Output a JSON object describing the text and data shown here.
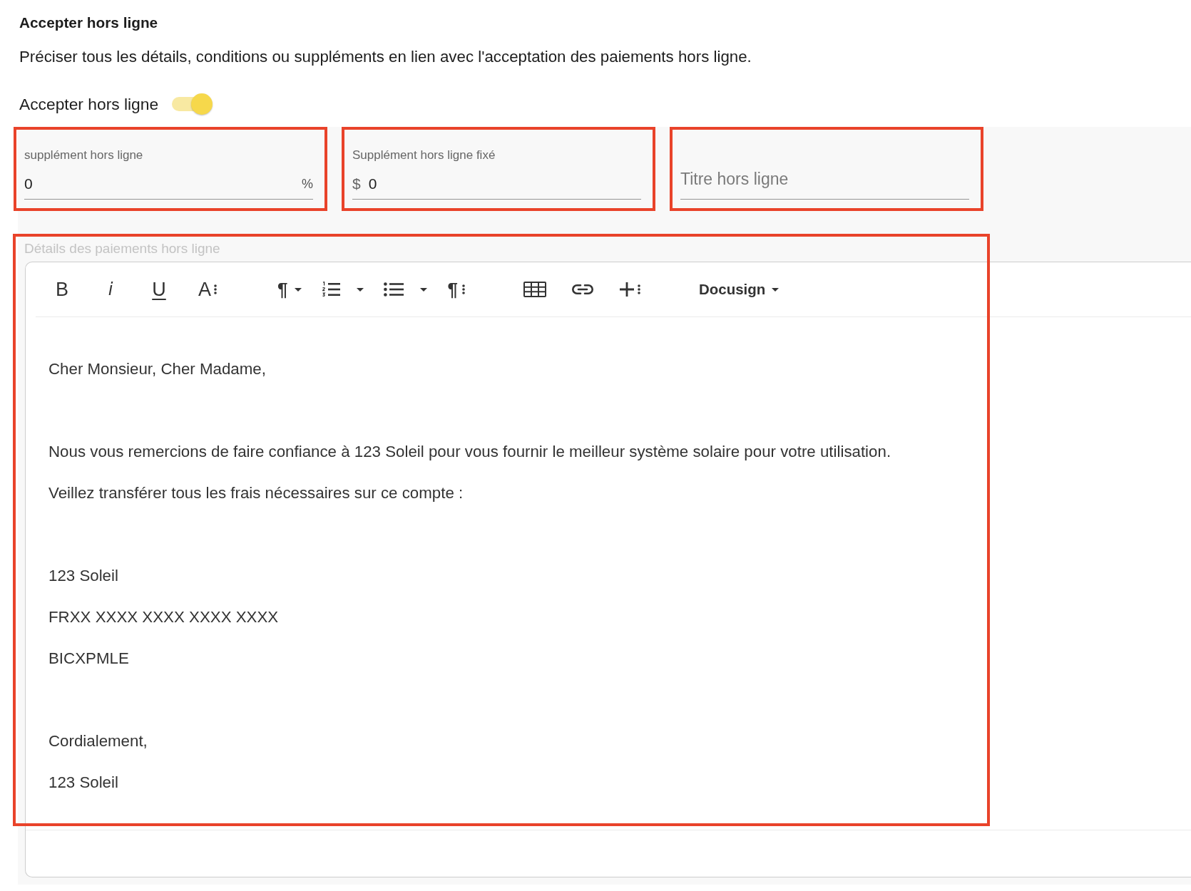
{
  "section": {
    "title": "Accepter hors ligne",
    "description": "Préciser tous les détails, conditions ou suppléments en lien avec l'acceptation des paiements hors ligne."
  },
  "offline_toggle": {
    "label": "Accepter hors ligne",
    "on": true
  },
  "fields": [
    {
      "label": "supplément hors ligne",
      "value": "0",
      "suffix": "%",
      "highlighted": true
    },
    {
      "label": "Supplément hors ligne fixé",
      "prefix": "$",
      "value": "0",
      "highlighted": true
    },
    {
      "placeholder": "Titre hors ligne",
      "highlighted": true
    }
  ],
  "editor": {
    "label": "Détails des paiements hors ligne",
    "highlighted": true,
    "toolbar": {
      "groups": [
        {
          "items": [
            {
              "kind": "bold",
              "label": "B"
            },
            {
              "kind": "italic",
              "label": "i"
            },
            {
              "kind": "underline",
              "label": "U"
            },
            {
              "kind": "text-style",
              "label": "A",
              "more": true
            }
          ]
        },
        {
          "items": [
            {
              "kind": "paragraph",
              "label": "¶",
              "dropdown": true
            },
            {
              "kind": "numbered-list",
              "dropdown": true
            },
            {
              "kind": "bullet-list",
              "dropdown": true
            },
            {
              "kind": "paragraph-style",
              "label": "¶",
              "more": true
            }
          ]
        },
        {
          "items": [
            {
              "kind": "table"
            },
            {
              "kind": "link"
            },
            {
              "kind": "insert",
              "more": true
            }
          ]
        },
        {
          "items": [
            {
              "kind": "menu",
              "label": "Docusign",
              "dropdown": true
            }
          ]
        }
      ]
    },
    "content": {
      "blocks": [
        {
          "lines": [
            "Cher Monsieur, Cher Madame,"
          ]
        },
        {
          "lines": [
            "Nous vous remercions de faire confiance à 123 Soleil pour vous fournir le meilleur système solaire pour votre utilisation.",
            "Veillez transférer tous les frais nécessaires sur ce compte :"
          ]
        },
        {
          "lines": [
            "123 Soleil",
            "FRXX XXXX XXXX XXXX XXXX",
            "BICXPMLE"
          ]
        },
        {
          "lines": [
            "Cordialement,",
            "123 Soleil"
          ]
        }
      ]
    }
  }
}
